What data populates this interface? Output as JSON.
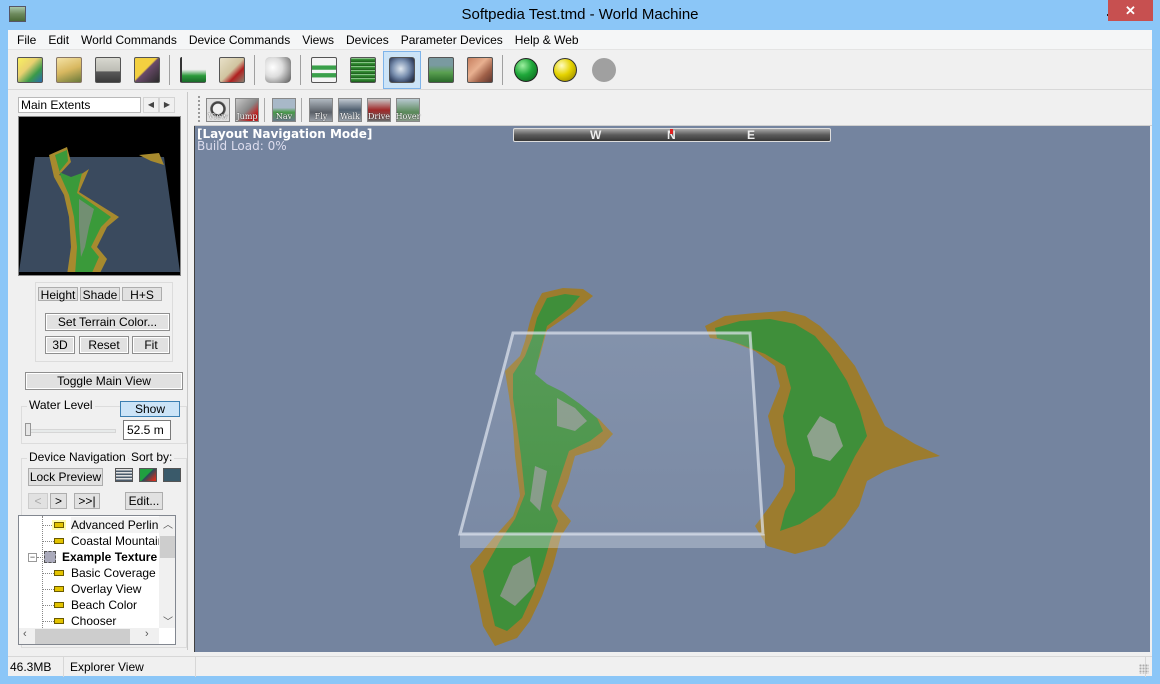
{
  "window": {
    "title": "Softpedia Test.tmd - World Machine",
    "close_glyph": "✕"
  },
  "menu": [
    "File",
    "Edit",
    "World Commands",
    "Device Commands",
    "Views",
    "Devices",
    "Parameter Devices",
    "Help & Web"
  ],
  "toolbar": {
    "buttons": [
      {
        "name": "new-world",
        "icon": "new-document-sparkle-icon"
      },
      {
        "name": "open-world",
        "icon": "open-folder-icon"
      },
      {
        "name": "save-world",
        "icon": "floppy-disk-icon"
      },
      {
        "name": "export",
        "icon": "export-arrow-icon"
      },
      {
        "name": "world-settings",
        "icon": "terrain-extents-icon"
      },
      {
        "name": "project-settings",
        "icon": "checklist-icon"
      },
      {
        "name": "randomize",
        "icon": "dice-icon"
      },
      {
        "name": "device-view",
        "icon": "device-graph-icon"
      },
      {
        "name": "layout-view",
        "icon": "layout-map-icon"
      },
      {
        "name": "explorer-view",
        "icon": "globe-icon",
        "active": true
      },
      {
        "name": "3d-view",
        "icon": "terrain-3d-icon"
      },
      {
        "name": "texture-view",
        "icon": "texture-icon"
      },
      {
        "name": "build",
        "icon": "green-ball-icon"
      },
      {
        "name": "build-preview",
        "icon": "yellow-ball-icon"
      },
      {
        "name": "stop",
        "icon": "gray-ball-icon"
      }
    ],
    "colors": {
      "green": "#1fa83a",
      "yellow": "#e5d300",
      "gray": "#a0a0a0",
      "active_bg": "#cce4f7"
    }
  },
  "left_panel": {
    "extents_label": "Main Extents",
    "prev_glyph": "◀",
    "next_glyph": "▶",
    "view_mode_buttons": [
      "Height",
      "Shade",
      "H+S"
    ],
    "set_terrain_color": "Set Terrain Color...",
    "view_buttons": [
      "3D",
      "Reset",
      "Fit"
    ],
    "toggle_main_view": "Toggle Main View",
    "water_level": {
      "label": "Water Level",
      "show_button": "Show",
      "value": "52.5 m",
      "slider_fraction": 0.0
    },
    "device_navigation": {
      "label": "Device Navigation",
      "sort_label": "Sort by:",
      "lock_preview": "Lock Preview",
      "nav_buttons": [
        "<",
        ">",
        ">>|"
      ],
      "edit_button": "Edit..."
    },
    "tree": [
      {
        "label": "Advanced Perlin",
        "level": 1,
        "type": "device",
        "highlighted": true
      },
      {
        "label": "Coastal Mountains",
        "level": 1,
        "type": "device"
      },
      {
        "label": "Example Texture",
        "level": 0,
        "type": "group",
        "bold": true,
        "expanded": true
      },
      {
        "label": "Basic Coverage",
        "level": 1,
        "type": "device"
      },
      {
        "label": "Overlay View",
        "level": 1,
        "type": "device"
      },
      {
        "label": "Beach Color",
        "level": 1,
        "type": "device"
      },
      {
        "label": "Chooser",
        "level": 1,
        "type": "device"
      }
    ]
  },
  "nav_toolbar": {
    "buttons": [
      "View",
      "Jump",
      "Nav",
      "Fly",
      "Walk",
      "Drive",
      "Hover"
    ]
  },
  "view3d": {
    "mode": "[Layout Navigation Mode]",
    "build_load": "Build Load: 0%",
    "compass": [
      "W",
      "N",
      "E"
    ],
    "background": "#74849f"
  },
  "statusbar": {
    "memory": "46.3MB",
    "view": "Explorer View"
  }
}
